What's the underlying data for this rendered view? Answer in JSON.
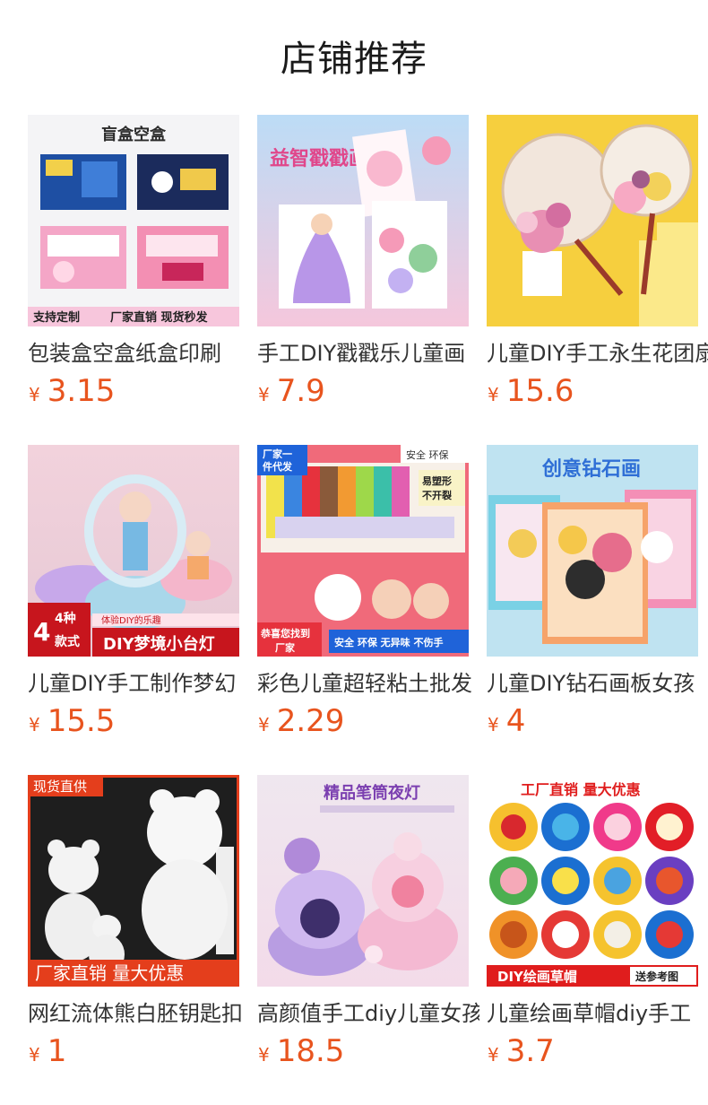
{
  "header": {
    "title": "店铺推荐"
  },
  "currency_symbol": "¥",
  "colors": {
    "price": "#e8541e",
    "title": "#1a1a1a",
    "name": "#333333"
  },
  "products": [
    {
      "name": "包装盒空盒纸盒印刷",
      "price": "3.15",
      "image_text": [
        "盲盒空盒",
        "支持定制",
        "厂家直销 现货秒发"
      ]
    },
    {
      "name": "手工DIY戳戳乐儿童画",
      "price": "7.9",
      "image_text": [
        "益智戳戳画"
      ]
    },
    {
      "name": "儿童DIY手工永生花团扇",
      "price": "15.6",
      "image_text": []
    },
    {
      "name": "儿童DIY手工制作梦幻",
      "price": "15.5",
      "image_text": [
        "4种",
        "款式",
        "体验DIY的乐趣",
        "DIY梦境小台灯"
      ]
    },
    {
      "name": "彩色儿童超轻粘土批发",
      "price": "2.29",
      "image_text": [
        "厂家一件代发",
        "安全 环保",
        "易塑形 不开裂",
        "恭喜您找到厂家",
        "安全 环保 无异味 不伤手"
      ]
    },
    {
      "name": "儿童DIY钻石画板女孩",
      "price": "4",
      "image_text": [
        "创意钻石画"
      ]
    },
    {
      "name": "网红流体熊白胚钥匙扣",
      "price": "1",
      "image_text": [
        "现货直供",
        "厂家直销 量大优惠"
      ]
    },
    {
      "name": "高颜值手工diy儿童女孩",
      "price": "18.5",
      "image_text": [
        "精品笔筒夜灯"
      ]
    },
    {
      "name": "儿童绘画草帽diy手工",
      "price": "3.7",
      "image_text": [
        "工厂直销 量大优惠",
        "DIY绘画草帽",
        "送参考图"
      ]
    }
  ]
}
